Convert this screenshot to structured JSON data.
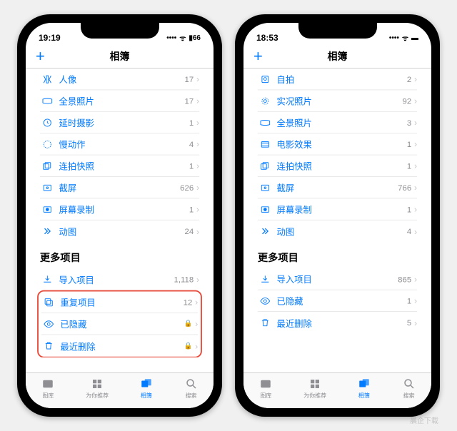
{
  "left": {
    "status_time": "19:19",
    "battery": "66",
    "nav_title": "相簿",
    "rows1": [
      {
        "icon": "portrait",
        "label": "人像",
        "count": "17"
      },
      {
        "icon": "pano",
        "label": "全景照片",
        "count": "17"
      },
      {
        "icon": "timelapse",
        "label": "延时摄影",
        "count": "1"
      },
      {
        "icon": "slomo",
        "label": "慢动作",
        "count": "4"
      },
      {
        "icon": "burst",
        "label": "连拍快照",
        "count": "1"
      },
      {
        "icon": "screenshot",
        "label": "截屏",
        "count": "626"
      },
      {
        "icon": "record",
        "label": "屏幕录制",
        "count": "1"
      },
      {
        "icon": "gif",
        "label": "动图",
        "count": "24"
      }
    ],
    "section_title": "更多项目",
    "rows2": [
      {
        "icon": "import",
        "label": "导入项目",
        "count": "1,118"
      }
    ],
    "rows3": [
      {
        "icon": "duplicate",
        "label": "重复项目",
        "count": "12"
      },
      {
        "icon": "hidden",
        "label": "已隐藏",
        "lock": true
      },
      {
        "icon": "trash",
        "label": "最近删除",
        "lock": true
      }
    ]
  },
  "right": {
    "status_time": "18:53",
    "nav_title": "相簿",
    "rows1": [
      {
        "icon": "selfie",
        "label": "自拍",
        "count": "2"
      },
      {
        "icon": "live",
        "label": "实况照片",
        "count": "92"
      },
      {
        "icon": "pano",
        "label": "全景照片",
        "count": "3"
      },
      {
        "icon": "cinema",
        "label": "电影效果",
        "count": "1"
      },
      {
        "icon": "burst",
        "label": "连拍快照",
        "count": "1"
      },
      {
        "icon": "screenshot",
        "label": "截屏",
        "count": "766"
      },
      {
        "icon": "record",
        "label": "屏幕录制",
        "count": "1"
      },
      {
        "icon": "gif",
        "label": "动图",
        "count": "4"
      }
    ],
    "section_title": "更多项目",
    "rows2": [
      {
        "icon": "import",
        "label": "导入项目",
        "count": "865"
      },
      {
        "icon": "hidden",
        "label": "已隐藏",
        "count": "1"
      },
      {
        "icon": "trash",
        "label": "最近删除",
        "count": "5"
      }
    ]
  },
  "tabs": [
    {
      "label": "图库"
    },
    {
      "label": "为你推荐"
    },
    {
      "label": "相簿",
      "active": true
    },
    {
      "label": "搜索"
    }
  ],
  "watermark": "晨企下载"
}
